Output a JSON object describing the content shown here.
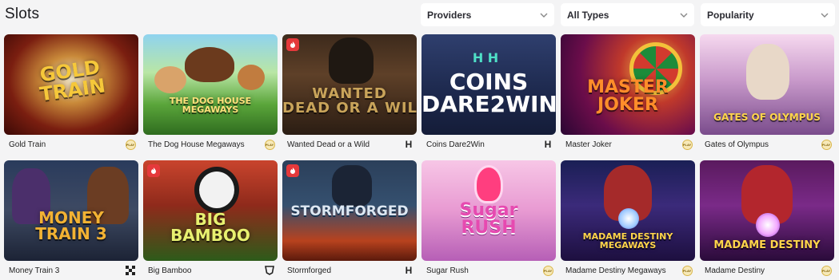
{
  "page": {
    "title": "Slots"
  },
  "filters": [
    {
      "label": "Providers"
    },
    {
      "label": "All Types"
    },
    {
      "label": "Popularity"
    }
  ],
  "games": [
    {
      "name": "Gold Train",
      "logo": "GOLD\nTRAIN",
      "provider_icon": "pragmatic-play-icon",
      "badge": false
    },
    {
      "name": "The Dog House Megaways",
      "logo": "THE DOG HOUSE\nMEGAWAYS",
      "provider_icon": "pragmatic-play-icon",
      "badge": false
    },
    {
      "name": "Wanted Dead or a Wild",
      "logo": "WANTED\nDEAD OR A WILD",
      "provider_icon": "hacksaw-icon",
      "badge": true
    },
    {
      "name": "Coins Dare2Win",
      "logo": "COINS\nDARE2WIN",
      "provider_icon": "hacksaw-icon",
      "badge": false
    },
    {
      "name": "Master Joker",
      "logo": "MASTER\nJOKER",
      "provider_icon": "pragmatic-play-icon",
      "badge": false
    },
    {
      "name": "Gates of Olympus",
      "logo": "GATES OF OLYMPUS",
      "provider_icon": "pragmatic-play-icon",
      "badge": false
    },
    {
      "name": "Money Train 3",
      "logo": "MONEY\nTRAIN 3",
      "provider_icon": "relax-gaming-icon",
      "badge": false
    },
    {
      "name": "Big Bamboo",
      "logo": "BIG\nBAMBOO",
      "provider_icon": "push-gaming-icon",
      "badge": true
    },
    {
      "name": "Stormforged",
      "logo": "STORMFORGED",
      "provider_icon": "hacksaw-icon",
      "badge": true
    },
    {
      "name": "Sugar Rush",
      "logo": "Sugar\nRUSH",
      "provider_icon": "pragmatic-play-icon",
      "badge": false
    },
    {
      "name": "Madame Destiny Megaways",
      "logo": "MADAME DESTINY\nMEGAWAYS",
      "provider_icon": "pragmatic-play-icon",
      "badge": false
    },
    {
      "name": "Madame Destiny",
      "logo": "MADAME DESTINY",
      "provider_icon": "pragmatic-play-icon",
      "badge": false
    }
  ],
  "provider_marks": {
    "pragmatic": "PLAY",
    "hacksaw": "H"
  }
}
